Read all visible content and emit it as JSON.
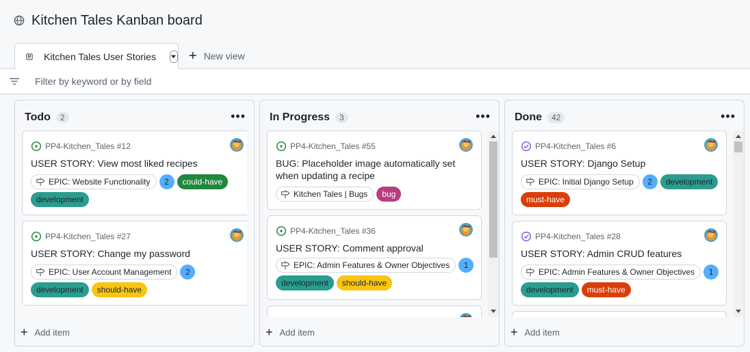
{
  "page": {
    "title": "Kitchen Tales Kanban board"
  },
  "views": {
    "active_tab": "Kitchen Tales User Stories",
    "new_view_label": "New view"
  },
  "filter": {
    "placeholder": "Filter by keyword or by field"
  },
  "colors": {
    "development": "#2a9d8f",
    "could_have": "#1f883d",
    "should_have": "#f9c513",
    "must_have": "#d93f0b",
    "bug": "#b83e7e",
    "open_issue": "#1a7f37",
    "closed_issue": "#8250df",
    "count_badge": "#54aeff"
  },
  "columns": [
    {
      "name": "Todo",
      "count": "2",
      "add_item": "Add item",
      "cards": [
        {
          "ref": "PP4-Kitchen_Tales #12",
          "title": "USER STORY: View most liked recipes",
          "status": "open",
          "epic": "EPIC: Website Functionality",
          "count": "2",
          "labels": [
            "could-have",
            "development"
          ]
        },
        {
          "ref": "PP4-Kitchen_Tales #27",
          "title": "USER STORY: Change my password",
          "status": "open",
          "epic": "EPIC: User Account Management",
          "count": "2",
          "labels": [
            "development",
            "should-have"
          ]
        }
      ]
    },
    {
      "name": "In Progress",
      "count": "3",
      "add_item": "Add item",
      "cards": [
        {
          "ref": "PP4-Kitchen_Tales #55",
          "title": "BUG: Placeholder image automatically set when updating a recipe",
          "status": "open",
          "epic": "Kitchen Tales | Bugs",
          "labels": [
            "bug"
          ]
        },
        {
          "ref": "PP4-Kitchen_Tales #36",
          "title": "USER STORY: Comment approval",
          "status": "open",
          "epic": "EPIC: Admin Features & Owner Objectives",
          "count": "1",
          "labels": [
            "development",
            "should-have"
          ]
        }
      ]
    },
    {
      "name": "Done",
      "count": "42",
      "add_item": "Add item",
      "cards": [
        {
          "ref": "PP4-Kitchen_Tales #6",
          "title": "USER STORY: Django Setup",
          "status": "closed",
          "epic": "EPIC: Initial Django Setup",
          "count": "2",
          "labels": [
            "development",
            "must-have"
          ]
        },
        {
          "ref": "PP4-Kitchen_Tales #28",
          "title": "USER STORY: Admin CRUD features",
          "status": "closed",
          "epic": "EPIC: Admin Features & Owner Objectives",
          "count": "1",
          "labels": [
            "development",
            "must-have"
          ]
        }
      ]
    }
  ]
}
